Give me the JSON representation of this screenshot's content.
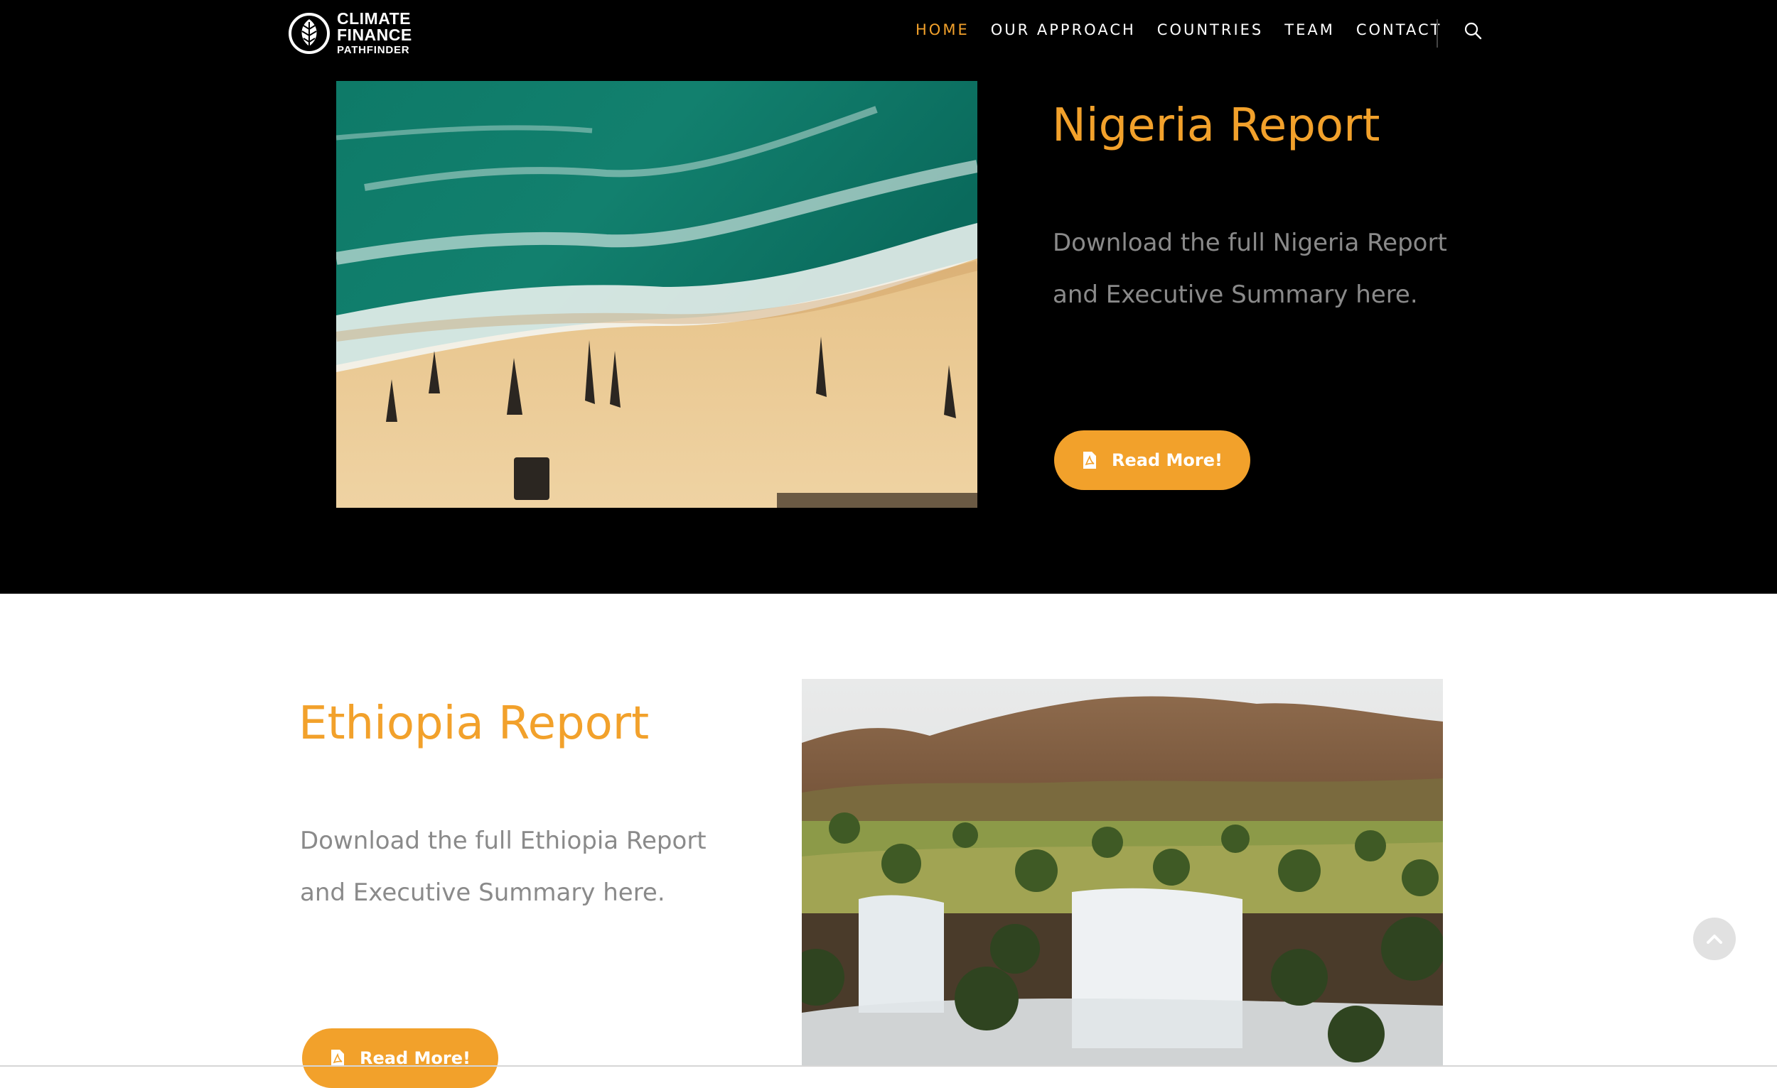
{
  "header": {
    "logo": {
      "line1": "CLIMATE",
      "line2": "FINANCE",
      "line3": "PATHFINDER"
    },
    "nav": [
      {
        "label": "HOME",
        "active": true
      },
      {
        "label": "OUR APPROACH",
        "active": false
      },
      {
        "label": "COUNTRIES",
        "active": false
      },
      {
        "label": "TEAM",
        "active": false
      },
      {
        "label": "CONTACT",
        "active": false
      }
    ],
    "search_icon": "search-icon"
  },
  "reports": [
    {
      "title": "Nigeria Report",
      "desc_line1": "Download the full Nigeria Report",
      "desc_line2": "and Executive Summary  here.",
      "button_label": "Read More!",
      "button_icon": "pdf-icon",
      "image": "aerial-beach-canoes"
    },
    {
      "title": "Ethiopia Report",
      "desc_line1": "Download the full Ethiopia Report",
      "desc_line2": "and Executive Summary  here.",
      "button_label": "Read More!",
      "button_icon": "pdf-icon",
      "image": "waterfall-landscape"
    }
  ],
  "back_to_top_icon": "chevron-up-icon",
  "colors": {
    "accent": "#f2a12b",
    "dark_bg": "#000000",
    "text_gray": "#8a8a8a"
  }
}
